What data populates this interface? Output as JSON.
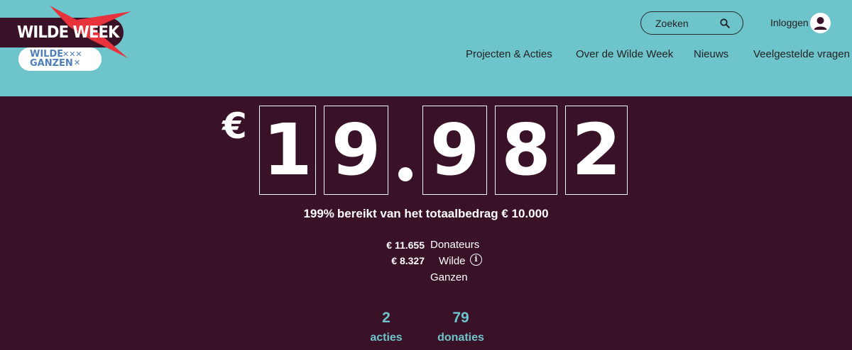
{
  "header": {
    "logo": {
      "title": "WILDE WEEK",
      "subtitle_line1": "WILDE",
      "subtitle_line2": "GANZEN",
      "brand_colors": {
        "pill": "#3a1228",
        "bird": "#e8323c",
        "badge_text": "#4f7fb8"
      }
    },
    "search": {
      "label": "Zoeken",
      "icon": "search-icon"
    },
    "login": {
      "label": "Inloggen",
      "icon": "user-icon"
    },
    "nav": [
      {
        "label": "Projecten & Acties"
      },
      {
        "label": "Over de Wilde Week"
      },
      {
        "label": "Nieuws"
      },
      {
        "label": "Veelgestelde vragen"
      }
    ],
    "background": "#6ec4cb"
  },
  "counter": {
    "currency": "€",
    "digits": [
      "1",
      "9",
      "9",
      "8",
      "2"
    ],
    "formatted": "19.982"
  },
  "progress": {
    "percent": "199%",
    "text": "bereikt van het totaalbedrag € 10.000"
  },
  "breakdown": [
    {
      "amount": "€ 11.655",
      "label": "Donateurs"
    },
    {
      "amount": "€ 8.327",
      "label_line1": "Wilde",
      "label_line2": "Ganzen",
      "info_icon": "info-icon"
    }
  ],
  "stats": [
    {
      "value": "2",
      "label": "acties"
    },
    {
      "value": "79",
      "label": "donaties"
    }
  ],
  "colors": {
    "page_background": "#3a1228",
    "accent": "#6ec4cb",
    "text": "#ffffff"
  }
}
